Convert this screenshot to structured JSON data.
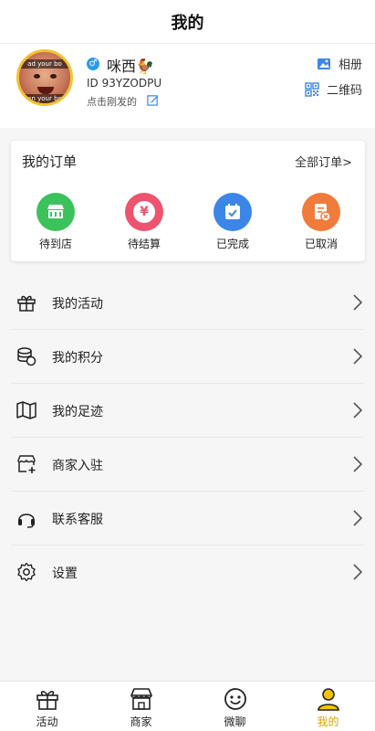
{
  "header": {
    "title": "我的"
  },
  "profile": {
    "nickname": "咪西🐓",
    "gender_symbol": "♂",
    "user_id": "ID 93YZODPU",
    "subtitle": "点击刚发的",
    "avatar_caption_top": "ad your bo",
    "avatar_caption_bottom": "an your bo",
    "album_label": "相册",
    "qrcode_label": "二维码"
  },
  "orders": {
    "title": "我的订单",
    "all_label": "全部订单>",
    "items": [
      {
        "label": "待到店",
        "color": "#3cc25b"
      },
      {
        "label": "待结算",
        "color": "#ee5470"
      },
      {
        "label": "已完成",
        "color": "#3c86e8"
      },
      {
        "label": "已取消",
        "color": "#f07b3a"
      }
    ],
    "yen_symbol": "¥"
  },
  "menu": {
    "items": [
      {
        "label": "我的活动",
        "icon": "gift-icon"
      },
      {
        "label": "我的积分",
        "icon": "coins-icon"
      },
      {
        "label": "我的足迹",
        "icon": "map-icon"
      },
      {
        "label": "商家入驻",
        "icon": "store-add-icon"
      },
      {
        "label": "联系客服",
        "icon": "headset-icon"
      },
      {
        "label": "设置",
        "icon": "gear-icon"
      }
    ]
  },
  "tabbar": {
    "items": [
      {
        "label": "活动",
        "icon": "gift-icon"
      },
      {
        "label": "商家",
        "icon": "store-icon"
      },
      {
        "label": "微聊",
        "icon": "chat-icon"
      },
      {
        "label": "我的",
        "icon": "user-icon"
      }
    ],
    "active_color": "#f5c400"
  }
}
